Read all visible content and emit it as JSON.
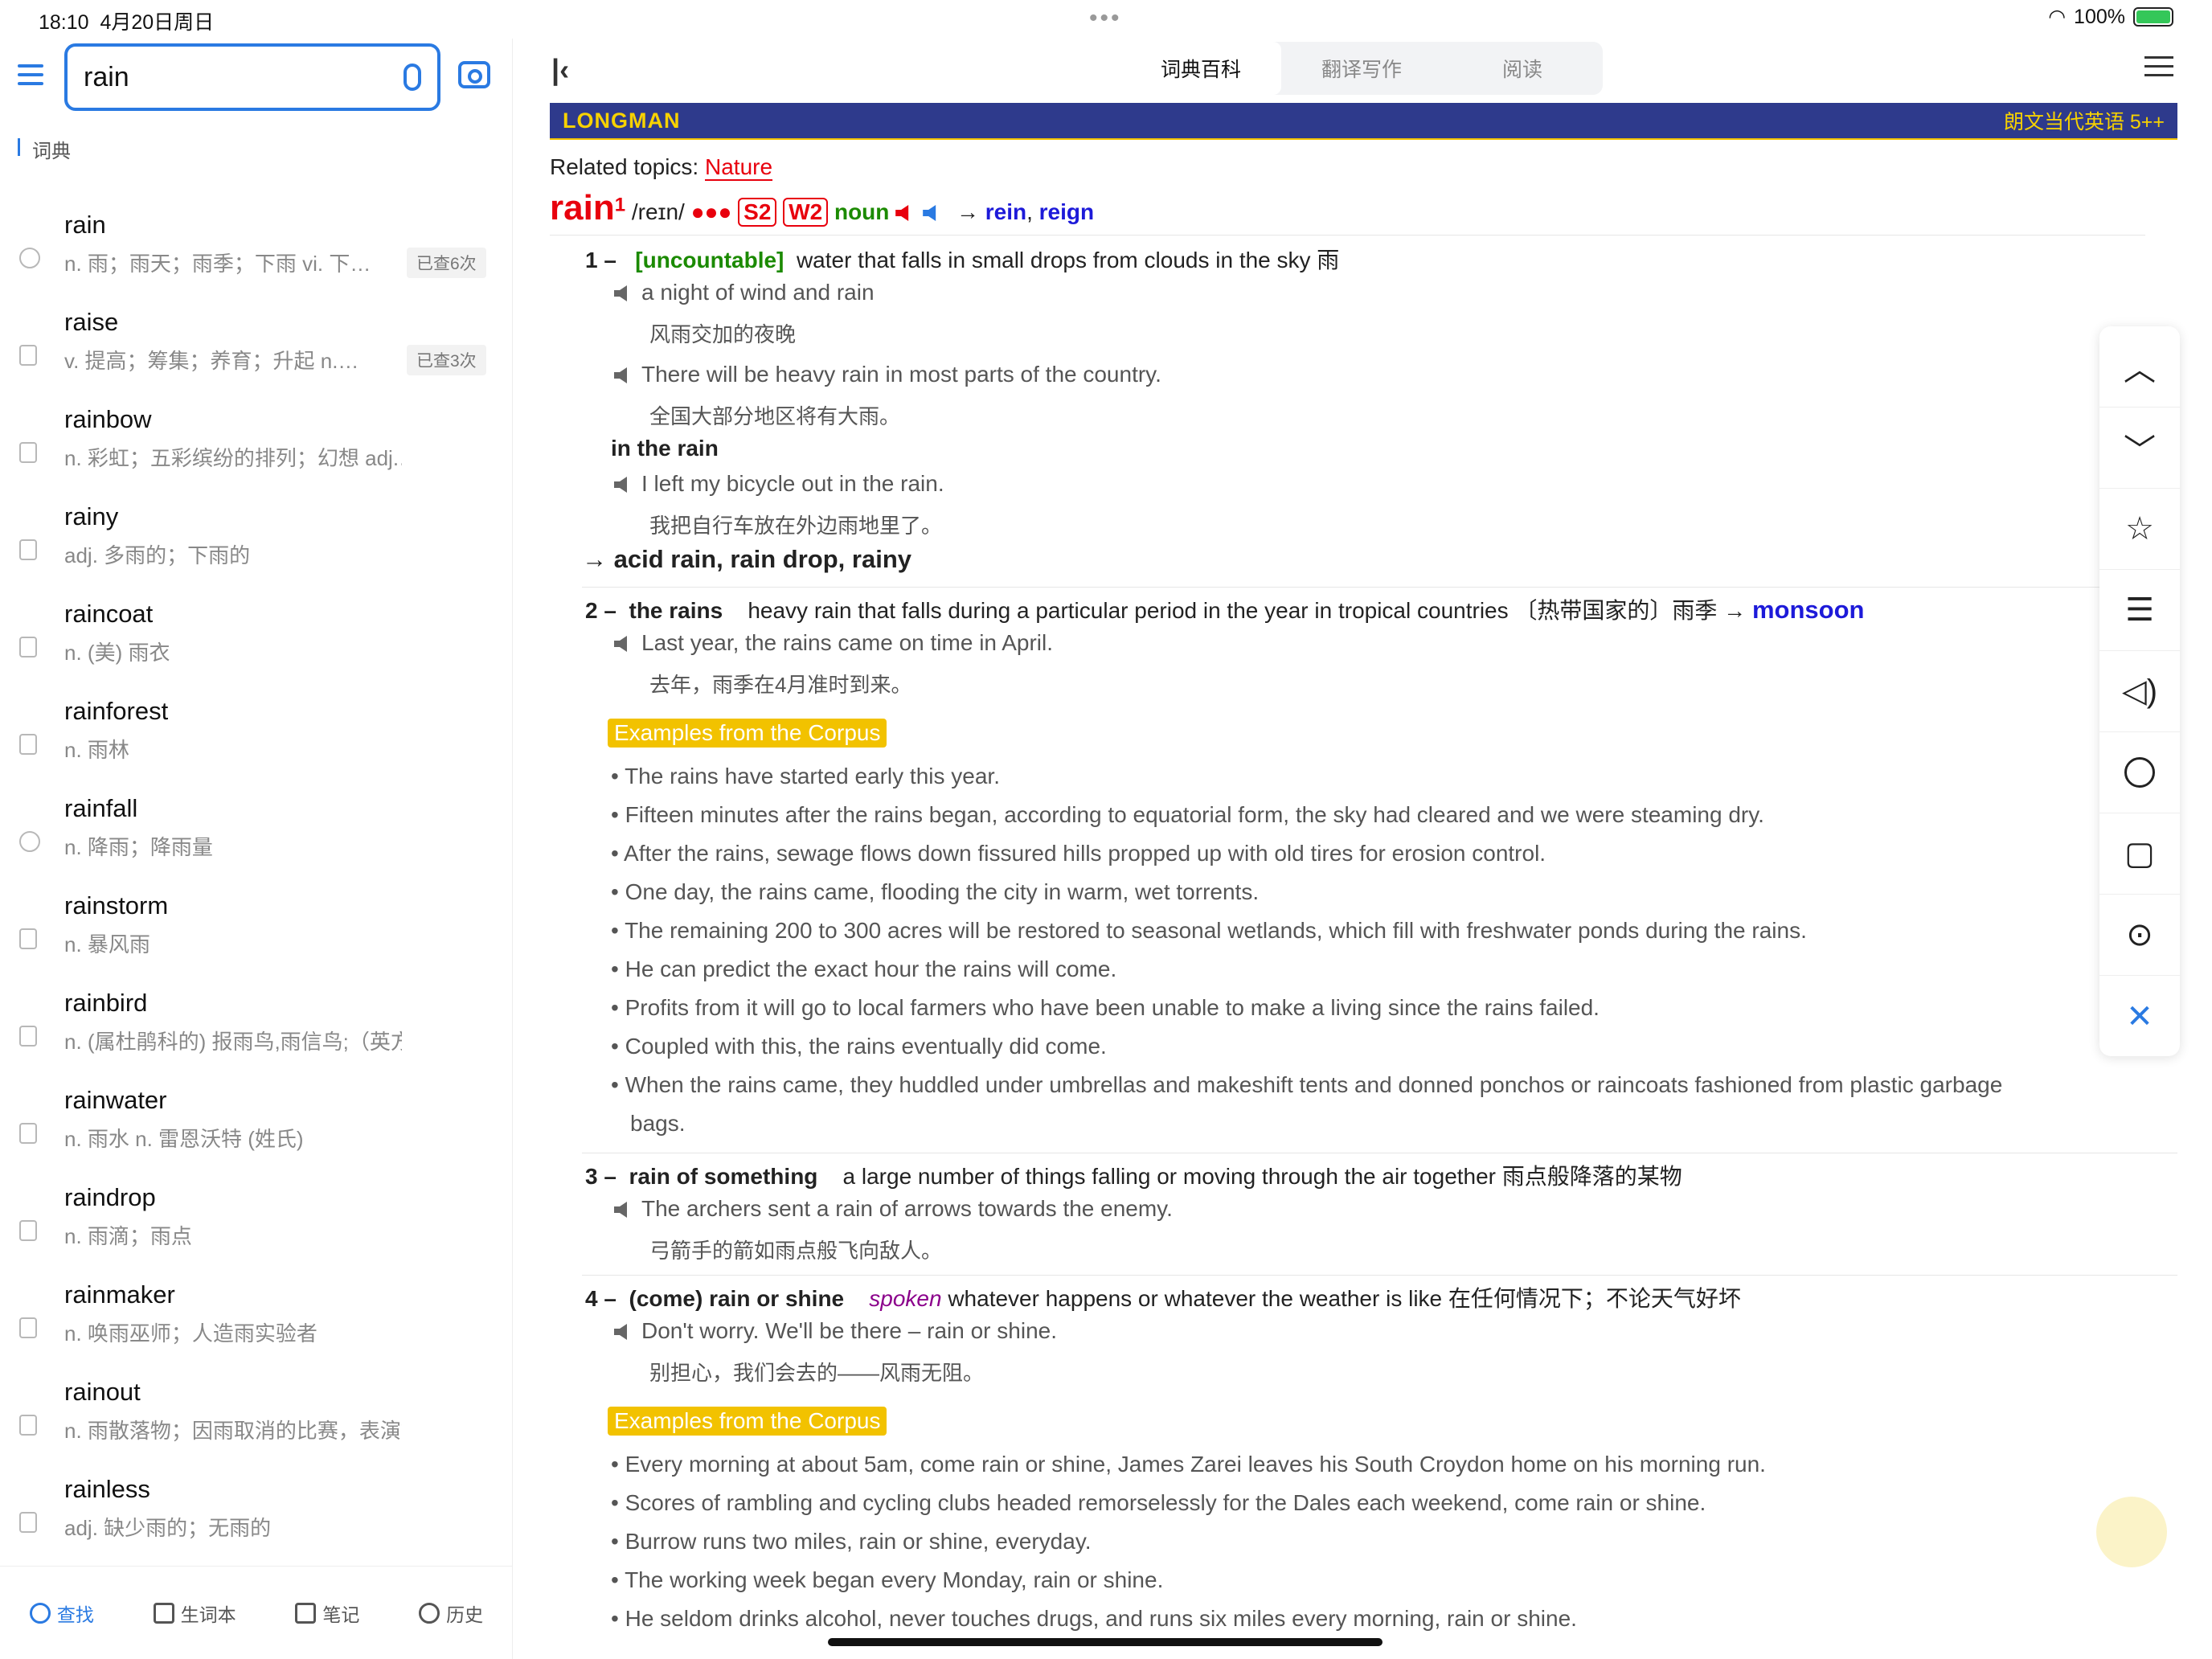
{
  "status": {
    "time": "18:10",
    "date": "4月20日周日",
    "battery": "100%"
  },
  "search": {
    "value": "rain"
  },
  "sidebar": {
    "section": "词典",
    "items": [
      {
        "word": "rain",
        "def": "n. 雨；雨天；雨季；下雨 vi. 下…",
        "badge": "已查6次",
        "icon": "history"
      },
      {
        "word": "raise",
        "def": "v. 提高；筹集；养育；升起 n.…",
        "badge": "已查3次",
        "icon": "doc"
      },
      {
        "word": "rainbow",
        "def": "n. 彩虹；五彩缤纷的排列；幻想 adj.…",
        "badge": "",
        "icon": "doc"
      },
      {
        "word": "rainy",
        "def": "adj. 多雨的；下雨的",
        "badge": "",
        "icon": "doc"
      },
      {
        "word": "raincoat",
        "def": "n. (美) 雨衣",
        "badge": "",
        "icon": "doc"
      },
      {
        "word": "rainforest",
        "def": "n. 雨林",
        "badge": "",
        "icon": "doc"
      },
      {
        "word": "rainfall",
        "def": "n. 降雨；降雨量",
        "badge": "",
        "icon": "history"
      },
      {
        "word": "rainstorm",
        "def": "n. 暴风雨",
        "badge": "",
        "icon": "doc"
      },
      {
        "word": "rainbird",
        "def": "n. (属杜鹃科的) 报雨鸟,雨信鸟;（英方）…",
        "badge": "",
        "icon": "doc"
      },
      {
        "word": "rainwater",
        "def": "n. 雨水 n. 雷恩沃特 (姓氏)",
        "badge": "",
        "icon": "doc"
      },
      {
        "word": "raindrop",
        "def": "n. 雨滴；雨点",
        "badge": "",
        "icon": "doc"
      },
      {
        "word": "rainmaker",
        "def": "n. 唤雨巫师；人造雨实验者",
        "badge": "",
        "icon": "doc"
      },
      {
        "word": "rainout",
        "def": "n. 雨散落物；因雨取消的比赛，表演等",
        "badge": "",
        "icon": "doc"
      },
      {
        "word": "rainless",
        "def": "adj. 缺少雨的；无雨的",
        "badge": "",
        "icon": "doc"
      }
    ],
    "tabs": [
      "查找",
      "生词本",
      "笔记",
      "历史"
    ]
  },
  "topbar": {
    "tabs": [
      "词典百科",
      "翻译写作",
      "阅读"
    ]
  },
  "banner": {
    "logo": "LONGMAN",
    "title": "朗文当代英语 5++"
  },
  "entry": {
    "related_label": "Related topics:",
    "related_topic": "Nature",
    "headword": "rain",
    "sup": "1",
    "pron": "/reɪn/",
    "freq": "●●●",
    "s": "S2",
    "w": "W2",
    "pos": "noun",
    "arrow": "→",
    "see": "rein",
    "see2": "reign",
    "comma": ",",
    "s1_num": "1 –",
    "s1_gram": "[uncountable]",
    "s1_def": "water that falls in small drops from clouds in the sky 雨",
    "ex1": "a night of wind and rain",
    "ex1_cn": "风雨交加的夜晚",
    "ex2": "There will be heavy rain in most parts of the country.",
    "ex2_cn": "全国大部分地区将有大雨。",
    "phrase1": "in the rain",
    "ex3": "I left my bicycle out in the rain.",
    "ex3_cn": "我把自行车放在外边雨地里了。",
    "compounds": "→ acid rain, rain drop, rainy",
    "s2_num": "2 –",
    "s2_head": "the rains",
    "s2_def": "heavy rain that falls during a particular period in the year in tropical countries 〔热带国家的〕雨季 →",
    "s2_see": "monsoon",
    "ex4": "Last year, the rains came on time in April.",
    "ex4_cn": "去年，雨季在4月准时到来。",
    "corpus_label": "Examples from the Corpus",
    "corpus1": [
      "The rains have started early this year.",
      "Fifteen minutes after the rains began, according to equatorial form, the sky had cleared and we were steaming dry.",
      "After the rains, sewage flows down fissured hills propped up with old tires for erosion control.",
      "One day, the rains came, flooding the city in warm, wet torrents.",
      "The remaining 200 to 300 acres will be restored to seasonal wetlands, which fill with freshwater ponds during the rains.",
      "He can predict the exact hour the rains will come.",
      "Profits from it will go to local farmers who have been unable to make a living since the rains failed.",
      "Coupled with this, the rains eventually did come.",
      "When the rains came, they huddled under umbrellas and makeshift tents and donned ponchos or raincoats fashioned from plastic garbage",
      "bags."
    ],
    "s3_num": "3 –",
    "s3_head": "rain of something",
    "s3_def": "a large number of things falling or moving through the air together 雨点般降落的某物",
    "ex5": "The archers sent a rain of arrows towards the enemy.",
    "ex5_cn": "弓箭手的箭如雨点般飞向敌人。",
    "s4_num": "4 –",
    "s4_head": "(come) rain or shine",
    "s4_reg": "spoken",
    "s4_def": "whatever happens or whatever the weather is like 在任何情况下；不论天气好坏",
    "ex6": "Don't worry. We'll be there – rain or shine.",
    "ex6_cn": "别担心，我们会去的——风雨无阻。",
    "corpus2": [
      "Every morning at about 5am, come rain or shine, James Zarei leaves his South Croydon home on his morning run.",
      "Scores of rambling and cycling clubs headed remorselessly for the Dales each weekend, come rain or shine.",
      "Burrow runs two miles, rain or shine, everyday.",
      "The working week began every Monday, rain or shine.",
      "He seldom drinks alcohol, never touches drugs, and runs six miles every morning, rain or shine."
    ]
  },
  "colors": {
    "accent": "#2a7ae2",
    "headword": "#e8000d",
    "banner": "#2e3a8c",
    "corpus": "#f2c200"
  }
}
